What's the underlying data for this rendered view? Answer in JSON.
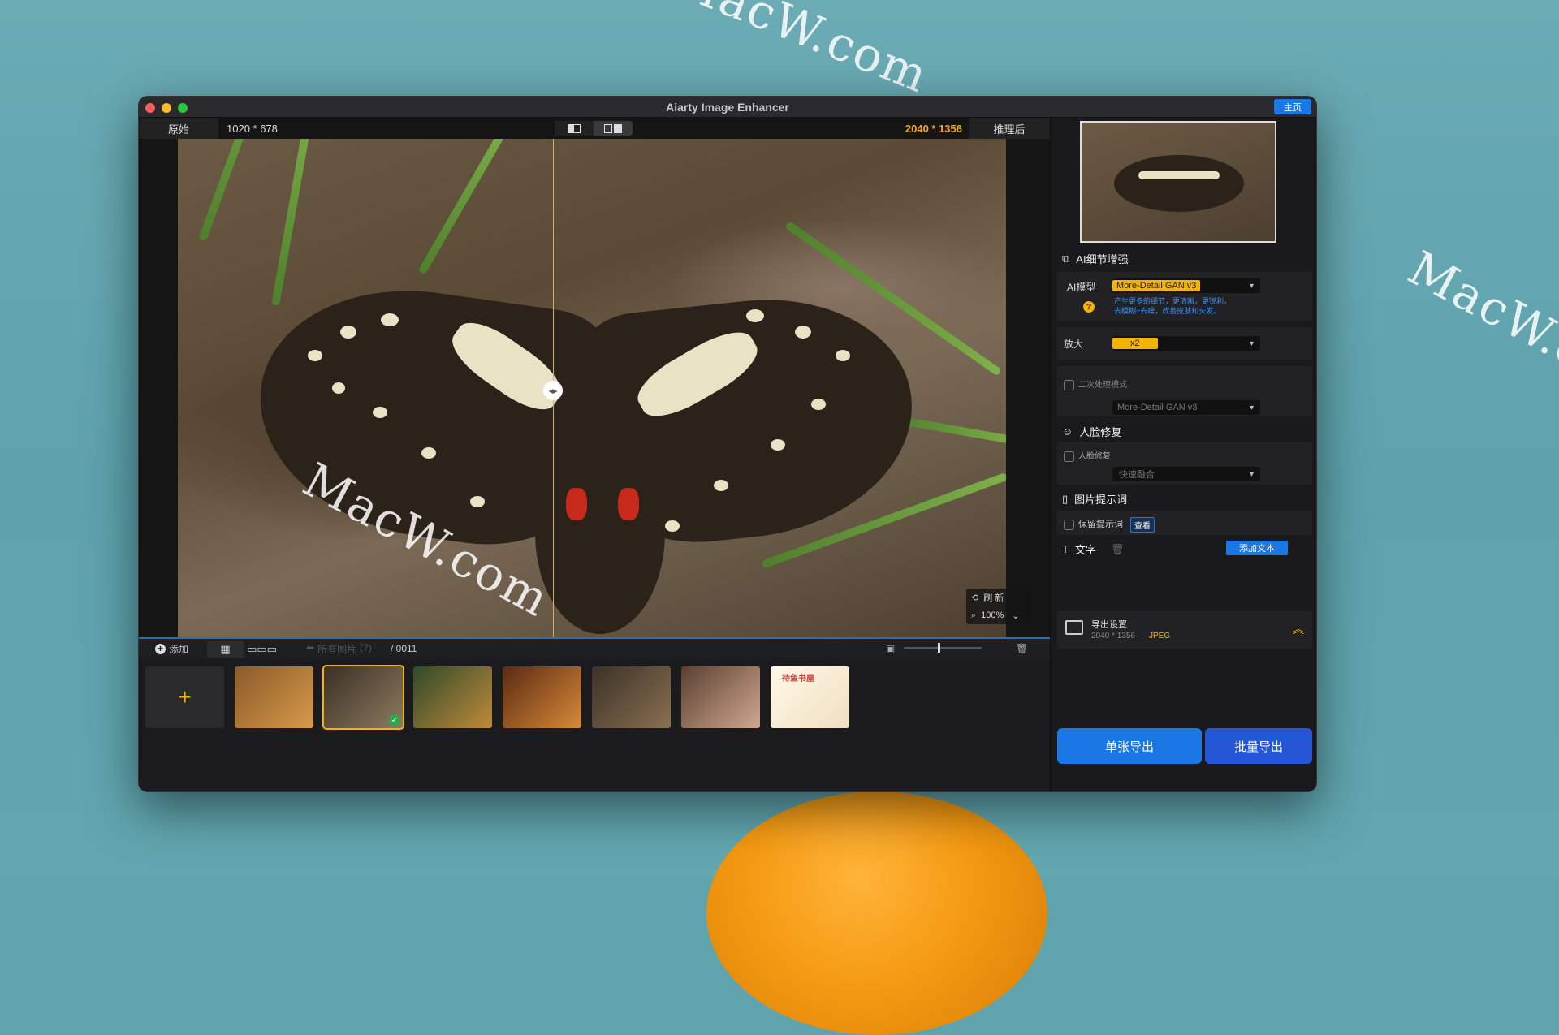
{
  "watermark": "MacW.com",
  "window": {
    "title": "Aiarty Image Enhancer",
    "home_label": "主页"
  },
  "compare": {
    "before_label": "原始",
    "before_size": "1020 * 678",
    "after_size": "2040 * 1356",
    "after_label": "推理后"
  },
  "zoom": {
    "refresh_label": "刷 新",
    "zoom_level": "100%"
  },
  "bottombar": {
    "add_label": "添加",
    "all_images_label": "所有图片",
    "all_images_count": "(7)",
    "index": "/ 0011",
    "add_glyph": "+"
  },
  "thumbnails": [
    {
      "name": "tiger",
      "colors": [
        "#8a5a2a",
        "#d89a4a"
      ]
    },
    {
      "name": "butterfly",
      "colors": [
        "#3a3026",
        "#8d7a5e"
      ],
      "selected": true
    },
    {
      "name": "jar-plant",
      "colors": [
        "#2f4a2a",
        "#c08a3a"
      ]
    },
    {
      "name": "burger",
      "colors": [
        "#5a2a12",
        "#d88a3a"
      ]
    },
    {
      "name": "dog-steampunk",
      "colors": [
        "#3a3228",
        "#8a7050"
      ]
    },
    {
      "name": "woman-portrait",
      "colors": [
        "#5a4030",
        "#d0a890"
      ]
    },
    {
      "name": "bear-sticker",
      "colors": [
        "#fff7e8",
        "#f0e0c0"
      ],
      "text": "待鱼书屋"
    }
  ],
  "panel": {
    "ai_enhance": {
      "title": "AI细节增强",
      "model_label": "AI模型",
      "model_value": "More-Detail GAN v3",
      "model_desc_1": "产生更多的细节，更清晰，更锐利，",
      "model_desc_2": "去模糊+去噪，改善皮肤和头发。",
      "help": "?"
    },
    "scale": {
      "label": "放大",
      "value": "x2"
    },
    "second_pass": {
      "label": "二次处理模式",
      "value": "More-Detail GAN v3"
    },
    "face": {
      "title": "人脸修复",
      "checkbox_label": "人脸修复",
      "mode_value": "快速融合"
    },
    "prompt": {
      "title": "图片提示词",
      "keep_label": "保留提示词",
      "view_label": "查看"
    },
    "text": {
      "title": "文字",
      "add_label": "添加文本"
    },
    "export": {
      "title": "导出设置",
      "size": "2040 * 1356",
      "format": "JPEG"
    },
    "single_export": "单张导出",
    "batch_export": "批量导出"
  },
  "colors": {
    "accent": "#1a78e6",
    "highlight": "#f5b400",
    "after_size": "#f5a623"
  }
}
